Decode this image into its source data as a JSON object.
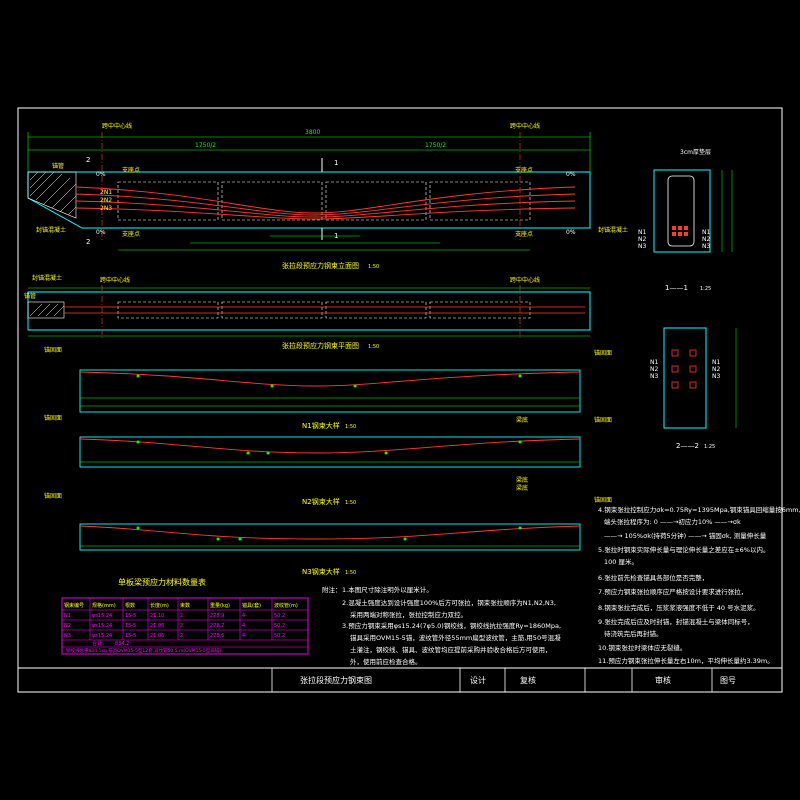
{
  "labels": {
    "midline_l": "跨中中心线",
    "midline_r": "跨中中心线",
    "anchor_tl": "锚管",
    "anchor_bl": "封锚混凝土",
    "anchor_br": "封锚混凝土",
    "tendon_n1": "2N1",
    "tendon_n2": "2N2",
    "tendon_n3": "2N3",
    "pt_l1": "支座点",
    "pt_l2": "支座点",
    "pt_r1": "支座点",
    "pt_r2": "支座点",
    "pct_tl": "0%",
    "pct_bl": "0%",
    "pct_tr": "0%",
    "pct_br": "0%",
    "sec1_top": "1",
    "sec1_bot": "1",
    "sec2_left": "2",
    "sec2_left_b": "2",
    "elev_title": "张拉段预应力钢束立面图",
    "elev_scale": "1:50",
    "plan_title": "张拉段预应力钢束平面图",
    "plan_scale": "1:50",
    "plan_midl": "跨中中心线",
    "plan_midr": "跨中中心线",
    "plan_anchor": "封锚混凝土",
    "plan_pipe": "锚管",
    "dim_top": "3800",
    "dim_l1": "1750/2",
    "dim_r1": "1750/2",
    "sec11_title": "1——1",
    "sec11_scale": "1:25",
    "sec22_title": "2——2",
    "sec22_scale": "1:25",
    "sec_top_label": "3cm厚垫层",
    "n1_label": "N1",
    "n2_label": "N2",
    "n3_label": "N3",
    "n1_label_b": "N1",
    "n2_label_b": "N2",
    "n3_label_b": "N3",
    "n1_label_r": "N1",
    "n2_label_r": "N2",
    "n3_label_r": "N3",
    "n1_label_rb": "N1",
    "n2_label_rb": "N2",
    "n3_label_rb": "N3",
    "n1_title": "N1钢束大样",
    "n1_scale": "1:50",
    "n2_title": "N2钢束大样",
    "n2_scale": "1:50",
    "n3_title": "N3钢束大样",
    "n3_scale": "1:50",
    "anchor_face_1": "锚固面",
    "anchor_face_2": "锚固面",
    "anchor_face_3": "锚固面",
    "anchor_face_4": "锚固面",
    "anchor_face_5": "锚固面",
    "anchor_face_6": "锚固面",
    "beam_bot_1": "梁底",
    "beam_bot_2": "梁底",
    "beam_bot_3": "梁底"
  },
  "table": {
    "title": "单板梁预应力材料数量表",
    "headers": [
      "钢束编号",
      "规格(mm)",
      "根数",
      "长度(m)",
      "束数",
      "重量(kg)",
      "锚具(套)",
      "波纹管(m)"
    ],
    "rows": [
      [
        "N1",
        "φs15.24",
        "15-5",
        "21.10",
        "2",
        "278.9",
        "4",
        "50.2"
      ],
      [
        "N2",
        "φs15.24",
        "15-5",
        "21.06",
        "2",
        "278.7",
        "4",
        "50.2"
      ],
      [
        "N3",
        "φs15.24",
        "15-5",
        "21.06",
        "2",
        "278.6",
        "4",
        "50.2"
      ]
    ],
    "total_label": "合计",
    "total_value": "834.2",
    "footer": "钢绞线总重834.1kg,锚具OVM15-5型12套,波纹管50.5 m(OVM15-5型扁锚)"
  },
  "notes_left": {
    "heading": "附注：",
    "n1": "1.本图尺寸除注明外以厘米计。",
    "n2": "2.混凝土强度达到设计强度100%后方可张拉，钢束张拉顺序为N1,N2,N3,",
    "n2b": "采用两端对称张拉，张拉控制应力双控。",
    "n3": "3.预应力钢束采用φs15.24(7φ5.0)钢绞线，钢绞线抗拉强度Ry=1860Mpa,",
    "n3b": "锚具采用OVM15-5锚，波纹管外径55mm扁型波纹管，主筋,用50号混凝",
    "n3c": "土灌注，钢绞线、锚具、波纹管均应提前采购并验收合格后方可使用，",
    "n3d": "外，使用前应检查合格。"
  },
  "notes_right": {
    "r4a": "4.钢束张拉控制应力σk=0.75Ry=1395Mpa,钢束锚具回缩量按6mm,",
    "r4b": "端头张拉程序为: 0 ——→初应力10% ——→σk",
    "r4c": "——→ 105%σk(持荷5分钟) ——→ 锚固σk, 测量伸长量",
    "r5": "5.张拉时钢束实际伸长量与理论伸长量之差应在±6%以内。",
    "r5b": "100 厘米。",
    "r6": "6.张拉前先检查锚具各部位是否完整，",
    "r7": "7.预应力钢束张拉顺序应严格按设计要求进行张拉，",
    "r8": "8.钢束张拉完成后，压浆浆液强度不低于 40 号水泥浆。",
    "r9": "9.张拉完成后应及时封锚，封锚混凝土与梁体同标号，",
    "r9b": "待浇筑完后再封锚。",
    "r10": "10.钢束张拉时梁体应无裂缝。",
    "r11": "11.预应力钢束张拉伸长量左右10m，平均伸长量约3.39m。"
  },
  "title_block": {
    "drawing_name": "张拉段预应力钢束图",
    "design": "设计",
    "check": "复核",
    "review": "审核",
    "drawing_no": "图号"
  },
  "colors": {
    "frame": "#ffffff",
    "beam": "#00ffff",
    "tendon": "#ff3b30",
    "text_yellow": "#ffff00",
    "text_green": "#00ff00",
    "table_magenta": "#ff00ff",
    "dim": "#00ff00"
  }
}
